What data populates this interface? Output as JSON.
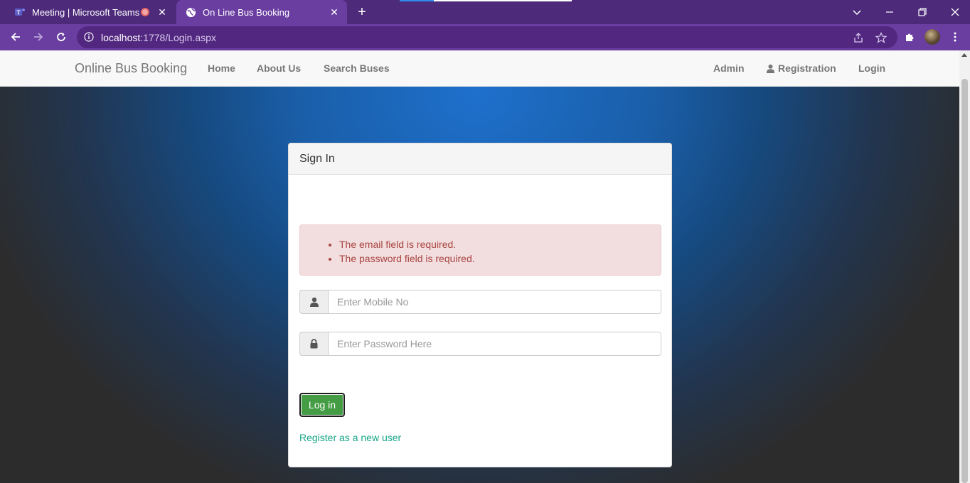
{
  "browser": {
    "tabs": [
      {
        "title": "Meeting | Microsoft Teams",
        "icon": "teams-icon",
        "recording": true
      },
      {
        "title": "On Line Bus Booking",
        "icon": "globe-icon",
        "active": true
      }
    ],
    "address": {
      "host": "localhost",
      "path": ":1778/Login.aspx"
    }
  },
  "site": {
    "brand": "Online Bus Booking",
    "nav_left": [
      "Home",
      "About Us",
      "Search Buses"
    ],
    "nav_right": {
      "admin": "Admin",
      "registration": "Registration",
      "login": "Login"
    }
  },
  "login_panel": {
    "heading": "Sign In",
    "errors": [
      "The email field is required.",
      "The password field is required."
    ],
    "mobile_placeholder": "Enter Mobile No",
    "password_placeholder": "Enter Password Here",
    "login_button": "Log in",
    "register_link": "Register as a new user"
  },
  "colors": {
    "browser_frame": "#6a3ea1",
    "success_button": "#449d44",
    "error_text": "#a94442",
    "link": "#18a689"
  }
}
